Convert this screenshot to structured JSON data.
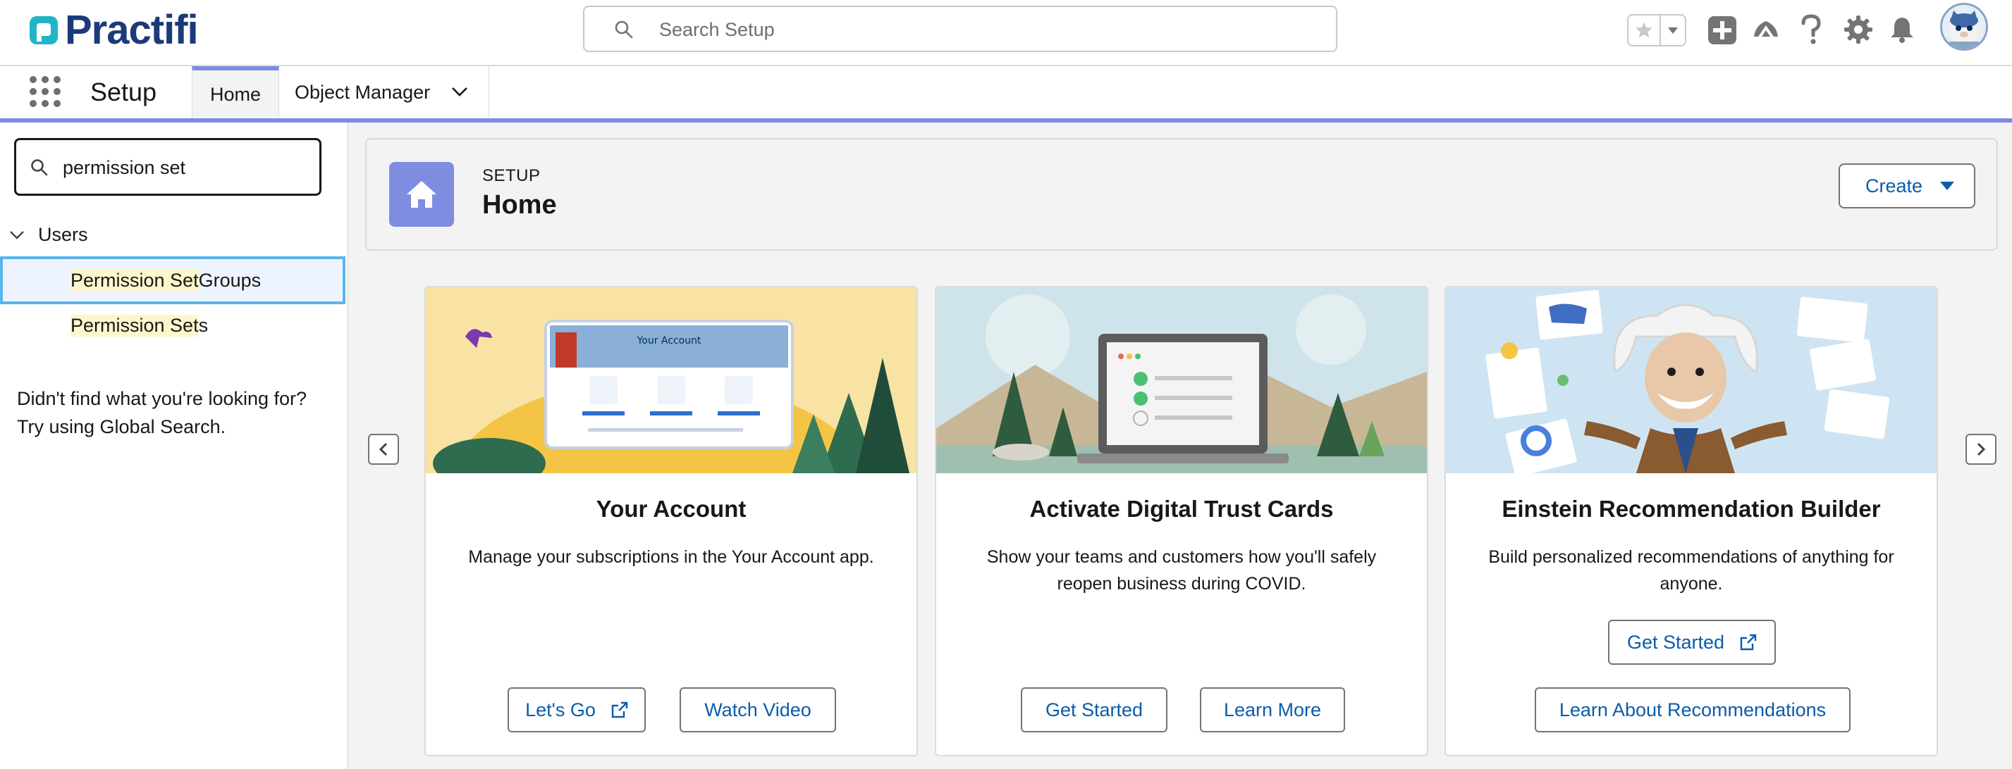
{
  "brand": {
    "name": "Practifi",
    "color": "#1b3a7a"
  },
  "global_search": {
    "placeholder": "Search Setup"
  },
  "header_icons": [
    "favorites-star-icon",
    "favorites-dropdown-icon",
    "global-actions-icon",
    "trailhead-icon",
    "help-icon",
    "setup-gear-icon",
    "notifications-bell-icon",
    "user-avatar"
  ],
  "context_bar": {
    "app_name": "Setup",
    "tabs": [
      {
        "label": "Home",
        "active": true
      },
      {
        "label": "Object Manager",
        "has_menu": true
      }
    ],
    "accent_color": "#7e8be4"
  },
  "sidebar": {
    "quick_find_value": "permission set",
    "tree": {
      "section_label": "Users",
      "items": [
        {
          "match": "Permission Set",
          "rest": " Groups",
          "selected": true
        },
        {
          "match": "Permission Set",
          "rest": "s",
          "selected": false
        }
      ]
    },
    "not_found_line1": "Didn't find what you're looking for?",
    "not_found_line2": "Try using Global Search."
  },
  "page_header": {
    "eyebrow": "SETUP",
    "title": "Home",
    "create_label": "Create",
    "icon_color": "#7f8de1"
  },
  "cards": [
    {
      "title": "Your Account",
      "description": "Manage your subscriptions in the Your Account app.",
      "art_label": "Your Account",
      "buttons": [
        {
          "label": "Let's Go",
          "external": true
        },
        {
          "label": "Watch Video",
          "external": false
        }
      ]
    },
    {
      "title": "Activate Digital Trust Cards",
      "description": "Show your teams and customers how you'll safely reopen business during COVID.",
      "buttons": [
        {
          "label": "Get Started",
          "external": false
        },
        {
          "label": "Learn More",
          "external": false
        }
      ]
    },
    {
      "title": "Einstein Recommendation Builder",
      "description": "Build personalized recommendations of anything for anyone.",
      "buttons": [
        {
          "label": "Get Started",
          "external": true
        },
        {
          "label": "Learn About Recommendations",
          "external": false
        }
      ]
    }
  ],
  "colors": {
    "link_blue": "#0b5cab",
    "selected_border": "#57b6ec",
    "search_highlight": "#fef7cd"
  }
}
